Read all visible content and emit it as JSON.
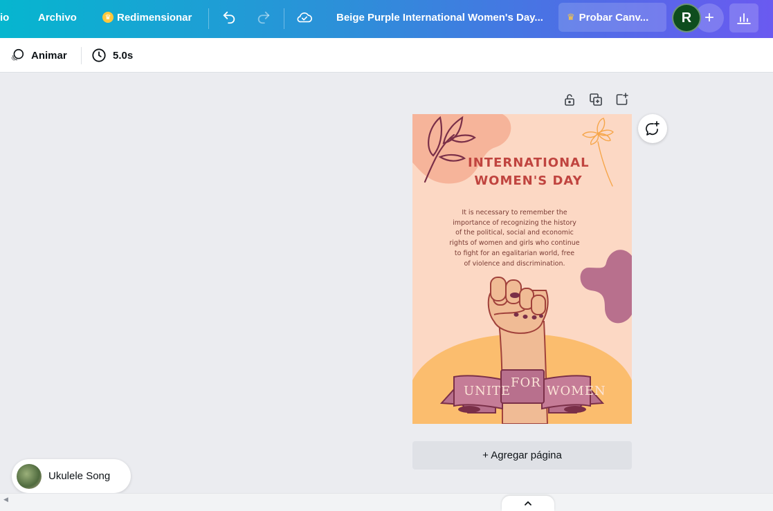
{
  "topbar": {
    "home_partial": "io",
    "file_label": "Archivo",
    "resize_label": "Redimensionar",
    "design_title": "Beige Purple International Women's Day...",
    "try_pro_label": "Probar Canv...",
    "avatar_initial": "R",
    "add_label": "+"
  },
  "toolbar": {
    "animate_label": "Animar",
    "duration_label": "5.0s"
  },
  "poster": {
    "title_line1": "INTERNATIONAL",
    "title_line2": "WOMEN'S DAY",
    "body_lines": [
      "It is necessary to remember the",
      "importance of recognizing the history",
      "of the political, social and economic",
      "rights of women and girls who continue",
      "to fight for an egalitarian world, free",
      "of violence and discrimination."
    ],
    "ribbon_left": "UNITE",
    "ribbon_center": "FOR",
    "ribbon_right": "WOMEN"
  },
  "canvas": {
    "add_page_label": "+ Agregar página"
  },
  "audio": {
    "track_name": "Ukulele Song"
  },
  "colors": {
    "page_bg": "#fcd8c4",
    "accent_red": "#c0443f",
    "ribbon_purple": "#b8708d",
    "sun_orange": "#fbbd6e"
  }
}
